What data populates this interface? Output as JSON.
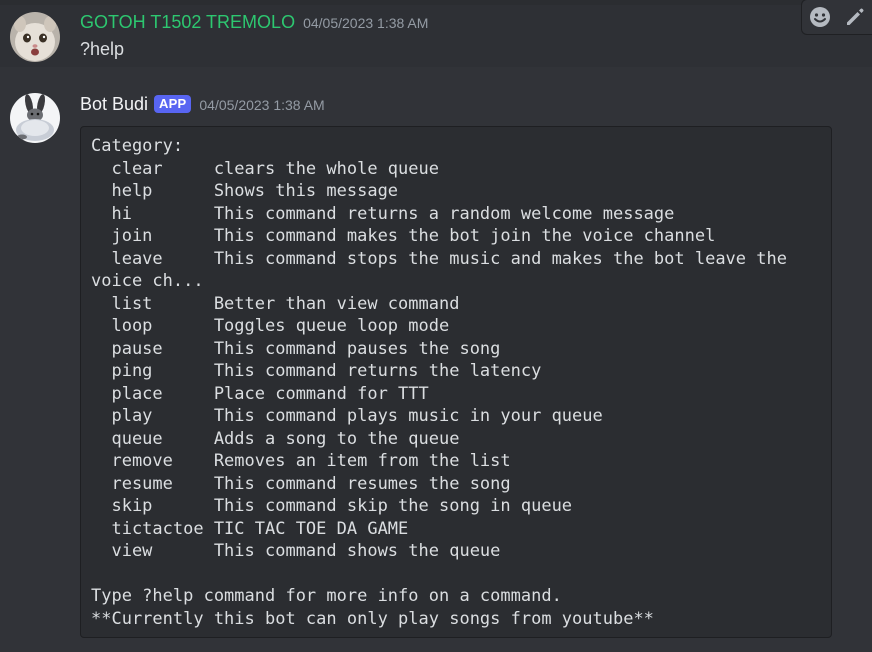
{
  "messages": [
    {
      "author": "GOTOH T1502 TREMOLO",
      "timestamp": "04/05/2023 1:38 AM",
      "content": "?help",
      "author_color": "#2dc770"
    },
    {
      "author": "Bot Budi",
      "badge": "APP",
      "timestamp": "04/05/2023 1:38 AM",
      "code_lines": [
        "Category:",
        "  clear     clears the whole queue",
        "  help      Shows this message",
        "  hi        This command returns a random welcome message",
        "  join      This command makes the bot join the voice channel",
        "  leave     This command stops the music and makes the bot leave the",
        "voice ch...",
        "  list      Better than view command",
        "  loop      Toggles queue loop mode",
        "  pause     This command pauses the song",
        "  ping      This command returns the latency",
        "  place     Place command for TTT",
        "  play      This command plays music in your queue",
        "  queue     Adds a song to the queue",
        "  remove    Removes an item from the list",
        "  resume    This command resumes the song",
        "  skip      This command skip the song in queue",
        "  tictactoe TIC TAC TOE DA GAME",
        "  view      This command shows the queue",
        "",
        "Type ?help command for more info on a command.",
        "**Currently this bot can only play songs from youtube**"
      ]
    }
  ],
  "hover_toolbar": {
    "icons": [
      "add-reaction-icon",
      "edit-icon"
    ]
  },
  "colors": {
    "background": "#313338",
    "code_background": "#2b2d31",
    "badge": "#5865f2",
    "text": "#dbdee1",
    "muted": "#949ba4"
  }
}
